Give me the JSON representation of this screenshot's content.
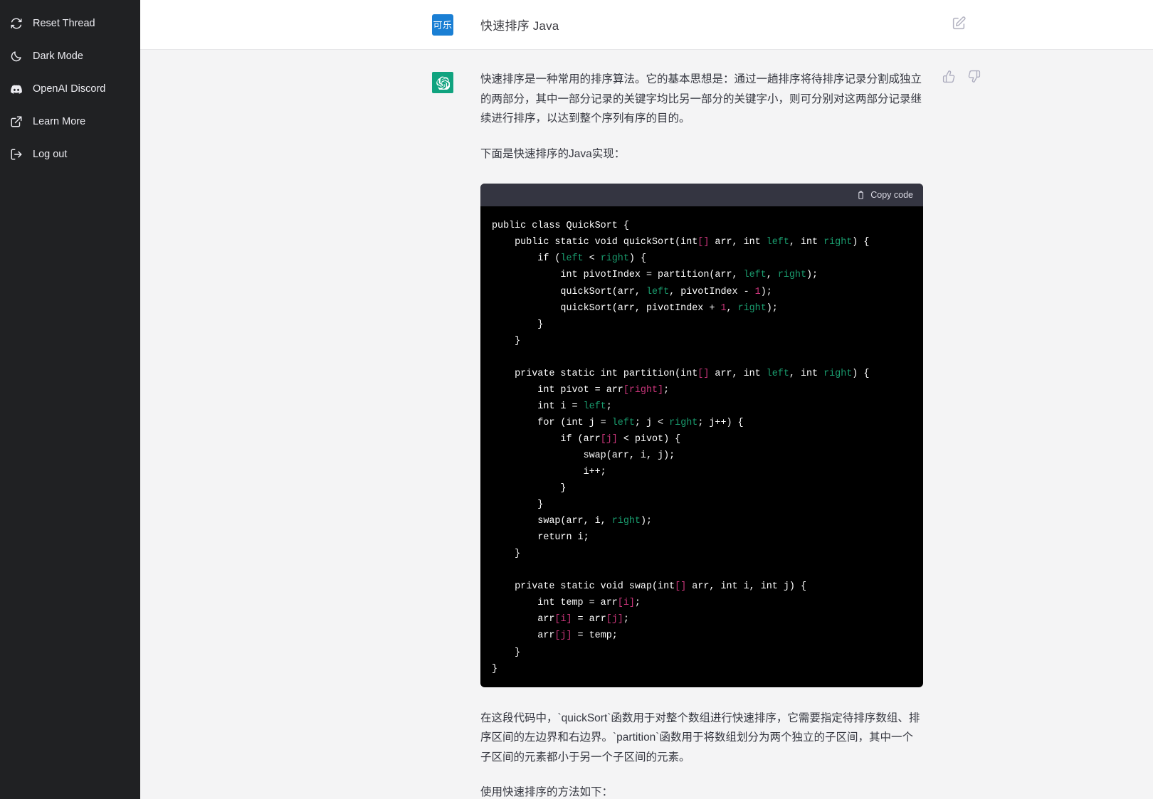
{
  "sidebar": {
    "items": [
      {
        "label": "Reset Thread",
        "icon": "reset-thread-icon"
      },
      {
        "label": "Dark Mode",
        "icon": "moon-icon"
      },
      {
        "label": "OpenAI Discord",
        "icon": "discord-icon"
      },
      {
        "label": "Learn More",
        "icon": "external-link-icon"
      },
      {
        "label": "Log out",
        "icon": "logout-icon"
      }
    ]
  },
  "header": {
    "avatar_text": "可乐",
    "avatar_color": "#1a7fd4",
    "title": "快速排序 Java",
    "edit_icon": "edit-square-icon"
  },
  "message": {
    "avatar_icon": "chatgpt-logo-icon",
    "avatar_color": "#10a37f",
    "paragraphs": [
      "快速排序是一种常用的排序算法。它的基本思想是：通过一趟排序将待排序记录分割成独立的两部分，其中一部分记录的关键字均比另一部分的关键字小，则可分别对这两部分记录继续进行排序，以达到整个序列有序的目的。",
      "下面是快速排序的Java实现："
    ],
    "after_code_paragraphs": [
      "在这段代码中，`quickSort`函数用于对整个数组进行快速排序，它需要指定待排序数组、排序区间的左边界和右边界。`partition`函数用于将数组划分为两个独立的子区间，其中一个子区间的元素都小于另一个子区间的元素。",
      "使用快速排序的方法如下："
    ],
    "feedback": {
      "thumbs_up": "thumbs-up-icon",
      "thumbs_down": "thumbs-down-icon"
    }
  },
  "code_block": {
    "copy_label": "Copy code",
    "copy_icon": "clipboard-icon",
    "language": "java",
    "colors": {
      "background": "#000000",
      "header_background": "#343541",
      "variable": "#1a9c6e",
      "index": "#c9357a",
      "number": "#c9357a"
    },
    "lines": [
      [
        {
          "t": "public class QuickSort {",
          "c": ""
        }
      ],
      [
        {
          "t": "    public static void quickSort(int",
          "c": ""
        },
        {
          "t": "[]",
          "c": "tok-idx"
        },
        {
          "t": " arr, int ",
          "c": ""
        },
        {
          "t": "left",
          "c": "tok-var"
        },
        {
          "t": ", int ",
          "c": ""
        },
        {
          "t": "right",
          "c": "tok-var"
        },
        {
          "t": ") {",
          "c": ""
        }
      ],
      [
        {
          "t": "        if (",
          "c": ""
        },
        {
          "t": "left",
          "c": "tok-var"
        },
        {
          "t": " < ",
          "c": ""
        },
        {
          "t": "right",
          "c": "tok-var"
        },
        {
          "t": ") {",
          "c": ""
        }
      ],
      [
        {
          "t": "            int pivotIndex = partition(arr, ",
          "c": ""
        },
        {
          "t": "left",
          "c": "tok-var"
        },
        {
          "t": ", ",
          "c": ""
        },
        {
          "t": "right",
          "c": "tok-var"
        },
        {
          "t": ");",
          "c": ""
        }
      ],
      [
        {
          "t": "            quickSort(arr, ",
          "c": ""
        },
        {
          "t": "left",
          "c": "tok-var"
        },
        {
          "t": ", pivotIndex - ",
          "c": ""
        },
        {
          "t": "1",
          "c": "tok-num"
        },
        {
          "t": ");",
          "c": ""
        }
      ],
      [
        {
          "t": "            quickSort(arr, pivotIndex + ",
          "c": ""
        },
        {
          "t": "1",
          "c": "tok-num"
        },
        {
          "t": ", ",
          "c": ""
        },
        {
          "t": "right",
          "c": "tok-var"
        },
        {
          "t": ");",
          "c": ""
        }
      ],
      [
        {
          "t": "        }",
          "c": ""
        }
      ],
      [
        {
          "t": "    }",
          "c": ""
        }
      ],
      [
        {
          "t": "",
          "c": ""
        }
      ],
      [
        {
          "t": "    private static int partition(int",
          "c": ""
        },
        {
          "t": "[]",
          "c": "tok-idx"
        },
        {
          "t": " arr, int ",
          "c": ""
        },
        {
          "t": "left",
          "c": "tok-var"
        },
        {
          "t": ", int ",
          "c": ""
        },
        {
          "t": "right",
          "c": "tok-var"
        },
        {
          "t": ") {",
          "c": ""
        }
      ],
      [
        {
          "t": "        int pivot = arr",
          "c": ""
        },
        {
          "t": "[right]",
          "c": "tok-idx"
        },
        {
          "t": ";",
          "c": ""
        }
      ],
      [
        {
          "t": "        int i = ",
          "c": ""
        },
        {
          "t": "left",
          "c": "tok-var"
        },
        {
          "t": ";",
          "c": ""
        }
      ],
      [
        {
          "t": "        for (int j = ",
          "c": ""
        },
        {
          "t": "left",
          "c": "tok-var"
        },
        {
          "t": "; j < ",
          "c": ""
        },
        {
          "t": "right",
          "c": "tok-var"
        },
        {
          "t": "; j++) {",
          "c": ""
        }
      ],
      [
        {
          "t": "            if (arr",
          "c": ""
        },
        {
          "t": "[j]",
          "c": "tok-idx"
        },
        {
          "t": " < pivot) {",
          "c": ""
        }
      ],
      [
        {
          "t": "                swap(arr, i, j);",
          "c": ""
        }
      ],
      [
        {
          "t": "                i++;",
          "c": ""
        }
      ],
      [
        {
          "t": "            }",
          "c": ""
        }
      ],
      [
        {
          "t": "        }",
          "c": ""
        }
      ],
      [
        {
          "t": "        swap(arr, i, ",
          "c": ""
        },
        {
          "t": "right",
          "c": "tok-var"
        },
        {
          "t": ");",
          "c": ""
        }
      ],
      [
        {
          "t": "        return i;",
          "c": ""
        }
      ],
      [
        {
          "t": "    }",
          "c": ""
        }
      ],
      [
        {
          "t": "",
          "c": ""
        }
      ],
      [
        {
          "t": "    private static void swap(int",
          "c": ""
        },
        {
          "t": "[]",
          "c": "tok-idx"
        },
        {
          "t": " arr, int i, int j) {",
          "c": ""
        }
      ],
      [
        {
          "t": "        int temp = arr",
          "c": ""
        },
        {
          "t": "[i]",
          "c": "tok-idx"
        },
        {
          "t": ";",
          "c": ""
        }
      ],
      [
        {
          "t": "        arr",
          "c": ""
        },
        {
          "t": "[i]",
          "c": "tok-idx"
        },
        {
          "t": " = arr",
          "c": ""
        },
        {
          "t": "[j]",
          "c": "tok-idx"
        },
        {
          "t": ";",
          "c": ""
        }
      ],
      [
        {
          "t": "        arr",
          "c": ""
        },
        {
          "t": "[j]",
          "c": "tok-idx"
        },
        {
          "t": " = temp;",
          "c": ""
        }
      ],
      [
        {
          "t": "    }",
          "c": ""
        }
      ],
      [
        {
          "t": "}",
          "c": ""
        }
      ]
    ]
  }
}
